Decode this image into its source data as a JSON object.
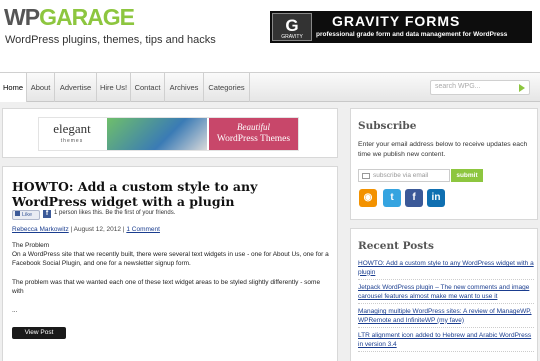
{
  "header": {
    "logo_wp": "WP",
    "logo_garage": "GARAGE",
    "tagline": "WordPress plugins, themes, tips and hacks",
    "banner": {
      "badge_letter": "G",
      "badge_small": "GRAVITY",
      "name": "GRAVITY FORMS",
      "subtitle": "professional grade form and data management for WordPress"
    }
  },
  "nav": {
    "items": [
      "Home",
      "About",
      "Advertise",
      "Hire Us!",
      "Contact",
      "Archives",
      "Categories"
    ],
    "active": "Home",
    "search_placeholder": "search WPG..."
  },
  "ad": {
    "brand": "elegant",
    "brand_sub": "themes",
    "headline1": "Beautiful",
    "headline2": "WordPress Themes"
  },
  "post": {
    "title": "HOWTO: Add a custom style to any WordPress widget with a plugin",
    "like_label": "Like",
    "like_text": "1 person likes this. Be the first of your friends.",
    "author": "Rebecca Markowitz",
    "date": "August 12, 2012",
    "comments": "1 Comment",
    "heading": "The Problem",
    "para1": "On a WordPress site that we recently built, there were several text widgets in use - one for About Us, one for a Facebook Social Plugin, and one for a newsletter signup form.",
    "para2": "The problem was that we wanted each one of these text widget areas to be styled slightly differently - some with",
    "ellipsis": "...",
    "view_button": "View Post"
  },
  "subscribe": {
    "title": "Subscribe",
    "text": "Enter your email address below to receive updates each time we publish new content.",
    "placeholder": "subscribe via email",
    "button": "submit"
  },
  "recent": {
    "title": "Recent Posts",
    "items": [
      "HOWTO: Add a custom style to any WordPress widget with a plugin",
      "Jetpack WordPress plugin – The new comments and image carousel features almost make me want to use it",
      "Managing multiple WordPress sites: A review of ManageWP, WPRemote and InfiniteWP (my fave)",
      "LTR alignment icon added to Hebrew and Arabic WordPress in version 3.4"
    ]
  },
  "colors": {
    "brand_green": "#8dc63f",
    "link_blue": "#1a3d8f",
    "facebook_blue": "#3b5998"
  }
}
